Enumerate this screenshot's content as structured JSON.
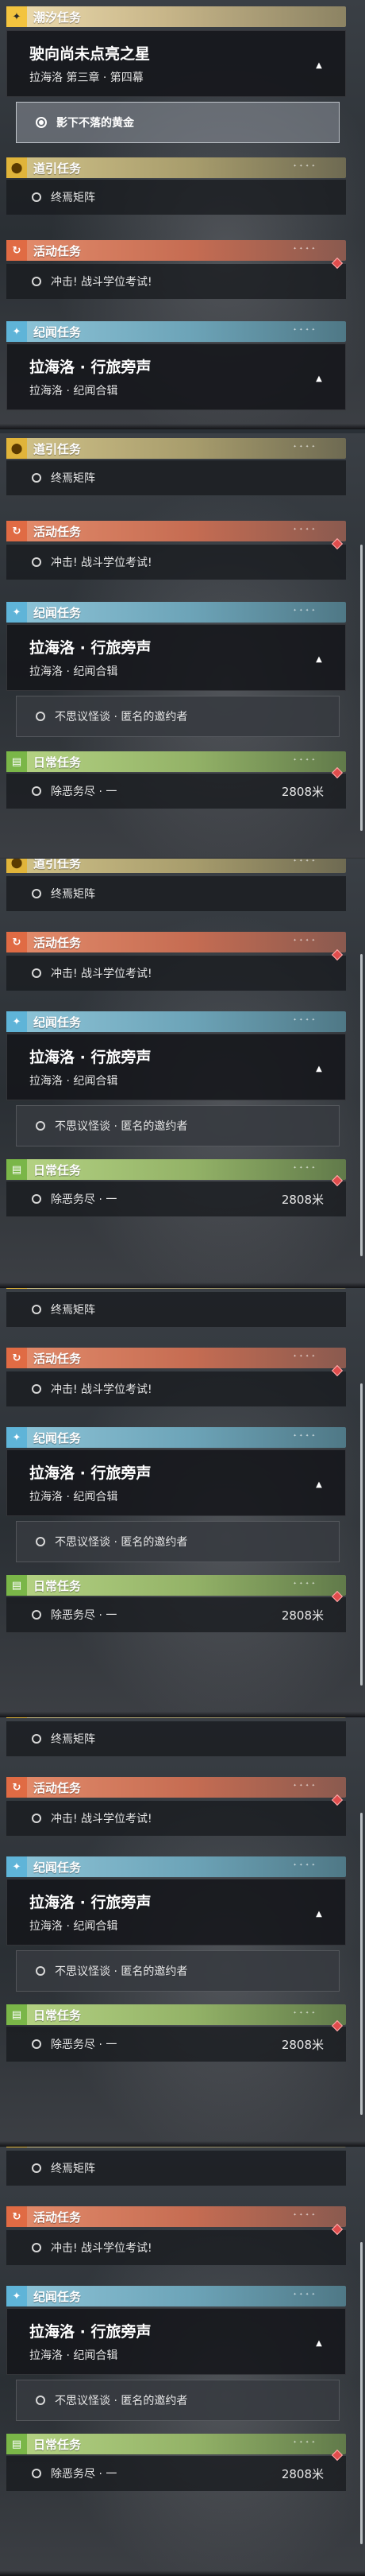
{
  "sections": {
    "chaoxi": {
      "label": "潮汐任务",
      "icon": "plus-star-icon"
    },
    "daoyin": {
      "label": "道引任务",
      "icon": "pin-icon"
    },
    "huodong": {
      "label": "活动任务",
      "icon": "event-icon"
    },
    "jiwen": {
      "label": "纪闻任务",
      "icon": "sparkle-icon"
    },
    "richang": {
      "label": "日常任务",
      "icon": "book-icon"
    }
  },
  "quests": {
    "chaoxi_title": "驶向尚未点亮之星",
    "chaoxi_sub": "拉海洛 第三章 · 第四幕",
    "chaoxi_step": "影下不落的黄金",
    "daoyin_item": "终焉矩阵",
    "huodong_item": "冲击! 战斗学位考试!",
    "jiwen_title": "拉海洛 · 行旅旁声",
    "jiwen_sub": "拉海洛 · 纪闻合辑",
    "jiwen_step": "不思议怪谈 · 匿名的邀约者",
    "richang_item": "除恶务尽 · 一",
    "richang_distance": "2808米"
  },
  "colors": {
    "chaoxi": "#f3c43f",
    "daoyin": "#e0b43a",
    "huodong": "#e06b44",
    "jiwen": "#5fb4d8",
    "richang": "#7ab648",
    "alert": "#e04d4d"
  }
}
